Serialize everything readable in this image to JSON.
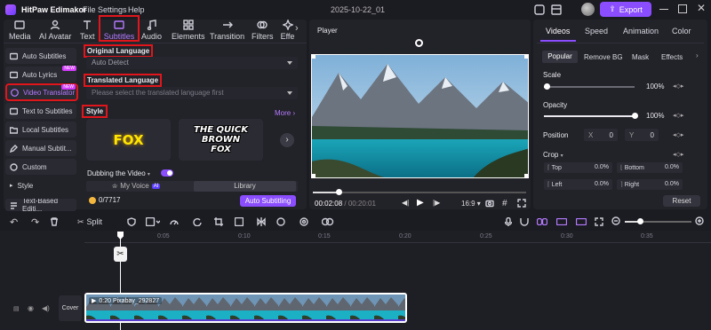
{
  "app": {
    "title": "HitPaw Edimakor",
    "menus": [
      "File",
      "Settings",
      "Help"
    ],
    "project_date": "2025-10-22_01",
    "export_label": "Export"
  },
  "toptabs": [
    {
      "label": "Media",
      "icon": "media-icon"
    },
    {
      "label": "AI Avatar",
      "icon": "ai-avatar-icon"
    },
    {
      "label": "Text",
      "icon": "text-icon"
    },
    {
      "label": "Subtitles",
      "icon": "subtitles-icon"
    },
    {
      "label": "Audio",
      "icon": "audio-icon"
    },
    {
      "label": "Elements",
      "icon": "elements-icon"
    },
    {
      "label": "Transition",
      "icon": "transition-icon"
    },
    {
      "label": "Filters",
      "icon": "filters-icon"
    },
    {
      "label": "Effe",
      "icon": "effects-icon"
    }
  ],
  "sidebar": {
    "items": [
      {
        "label": "Auto Subtitles"
      },
      {
        "label": "Auto Lyrics",
        "badge": "NEW"
      },
      {
        "label": "Video Translator",
        "badge": "NEW"
      },
      {
        "label": "Text to Subtitles"
      },
      {
        "label": "Local Subtitles"
      },
      {
        "label": "Manual Subtit..."
      },
      {
        "label": "Custom"
      },
      {
        "label": "Style"
      },
      {
        "label": "Text-Based Editi..."
      }
    ]
  },
  "translator": {
    "original_language_label": "Original Language",
    "original_language_value": "Auto Detect",
    "translated_language_label": "Translated Language",
    "translated_language_placeholder": "Please select the translated language first",
    "style_label": "Style",
    "more_label": "More",
    "style_cards": [
      "FOX",
      "THE QUICK BROWN FOX"
    ],
    "dubbing_label": "Dubbing the Video",
    "my_voice_label": "My Voice",
    "ai_badge": "AI",
    "library_label": "Library",
    "credits": "0/7717",
    "auto_button": "Auto Subtitling"
  },
  "player": {
    "title": "Player",
    "current_time": "00:02:08",
    "total_time": "00:20:01",
    "aspect": "16:9",
    "progress": 0.12
  },
  "right_panel": {
    "tabs": [
      "Videos",
      "Speed",
      "Animation",
      "Color"
    ],
    "subtabs": [
      "Popular",
      "Remove BG",
      "Mask",
      "Effects"
    ],
    "scale_label": "Scale",
    "scale_value": "100%",
    "scale_level": 0.01,
    "opacity_label": "Opacity",
    "opacity_value": "100%",
    "opacity_level": 1.0,
    "position_label": "Position",
    "pos_x_label": "X",
    "pos_x": "0",
    "pos_y_label": "Y",
    "pos_y": "0",
    "crop_label": "Crop",
    "crop_top_label": "Top",
    "crop_top": "0.0%",
    "crop_bottom_label": "Bottom",
    "crop_bottom": "0.0%",
    "crop_left_label": "Left",
    "crop_left": "0.0%",
    "crop_right_label": "Right",
    "crop_right": "0.0%",
    "reset_label": "Reset"
  },
  "timeline": {
    "split_label": "Split",
    "ruler": [
      "0:05",
      "0:10",
      "0:15",
      "0:20",
      "0:25",
      "0:30",
      "0:35"
    ],
    "cover_label": "Cover",
    "clip_label": "0:20 Pixabay_292827"
  },
  "colors": {
    "accent": "#8a4dff",
    "annotation": "#e0161c",
    "bg": "#1b1b22"
  }
}
